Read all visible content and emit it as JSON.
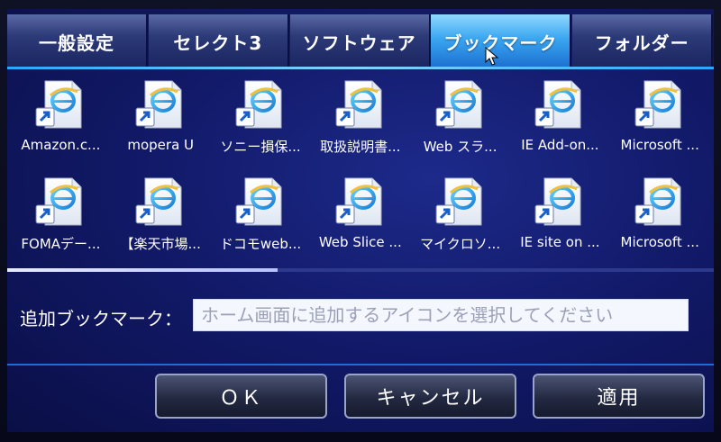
{
  "tabs": [
    {
      "label": "一般設定",
      "active": false
    },
    {
      "label": "セレクト3",
      "active": false
    },
    {
      "label": "ソフトウェア",
      "active": false
    },
    {
      "label": "ブックマーク",
      "active": true
    },
    {
      "label": "フォルダー",
      "active": false
    }
  ],
  "bookmarks": [
    {
      "label": "Amazon.c..."
    },
    {
      "label": "mopera U"
    },
    {
      "label": "ソニー損保..."
    },
    {
      "label": "取扱説明書..."
    },
    {
      "label": "Web スラ..."
    },
    {
      "label": "IE Add-on..."
    },
    {
      "label": "Microsoft ..."
    },
    {
      "label": "FOMAデー..."
    },
    {
      "label": "【楽天市場..."
    },
    {
      "label": "ドコモweb..."
    },
    {
      "label": "Web Slice ..."
    },
    {
      "label": "マイクロソ..."
    },
    {
      "label": "IE site on ..."
    },
    {
      "label": "Microsoft ..."
    }
  ],
  "add_bookmark": {
    "label": "追加ブックマーク：",
    "placeholder": "ホーム画面に追加するアイコンを選択してください",
    "value": ""
  },
  "buttons": {
    "ok": "ＯＫ",
    "cancel": "キャンセル",
    "apply": "適用"
  },
  "icon": "internet-shortcut-icon",
  "colors": {
    "active_tab": "#3aa6f0",
    "background": "#121a6a",
    "accent_line": "#2aa8ff"
  }
}
